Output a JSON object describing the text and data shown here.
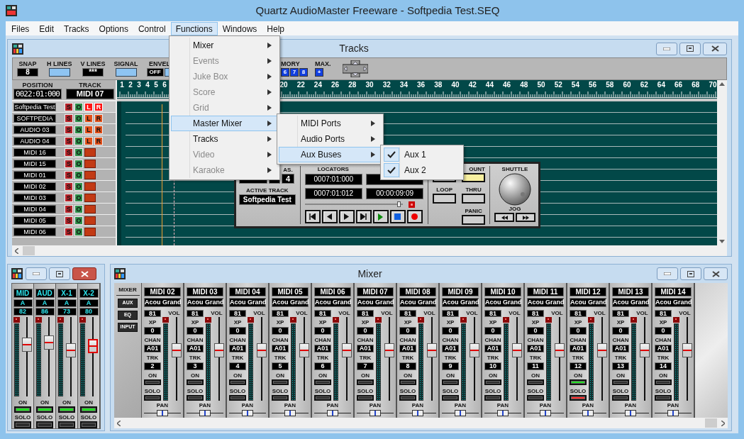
{
  "window": {
    "title": "Quartz AudioMaster Freeware - Softpedia Test.SEQ"
  },
  "menu_bar": [
    {
      "label": "Files",
      "selected": false
    },
    {
      "label": "Edit",
      "selected": false
    },
    {
      "label": "Tracks",
      "selected": false
    },
    {
      "label": "Options",
      "selected": false
    },
    {
      "label": "Control",
      "selected": false
    },
    {
      "label": "Functions",
      "selected": true
    },
    {
      "label": "Windows",
      "selected": false
    },
    {
      "label": "Help",
      "selected": false
    }
  ],
  "functions_menu": [
    {
      "label": "Mixer",
      "disabled": false,
      "selected": false
    },
    {
      "label": "Events",
      "disabled": true,
      "selected": false
    },
    {
      "label": "Juke Box",
      "disabled": true,
      "selected": false
    },
    {
      "label": "Score",
      "disabled": true,
      "selected": false
    },
    {
      "label": "Grid",
      "disabled": true,
      "selected": false
    },
    {
      "label": "Master Mixer",
      "disabled": false,
      "selected": true
    },
    {
      "label": "Tracks",
      "disabled": false,
      "selected": false
    },
    {
      "label": "Video",
      "disabled": true,
      "selected": false
    },
    {
      "label": "Karaoke",
      "disabled": true,
      "selected": false
    }
  ],
  "master_mixer_menu": [
    {
      "label": "MIDI Ports",
      "selected": false
    },
    {
      "label": "Audio Ports",
      "selected": false
    },
    {
      "label": "Aux Buses",
      "selected": true
    }
  ],
  "aux_buses_menu": [
    {
      "label": "Aux 1",
      "checked": true
    },
    {
      "label": "Aux 2",
      "checked": true
    }
  ],
  "tracks_window": {
    "title": "Tracks",
    "toolbar": [
      {
        "kind": "display",
        "label": "SNAP",
        "value": "8"
      },
      {
        "kind": "toggle",
        "label": "H LINES"
      },
      {
        "kind": "display",
        "label": "V LINES",
        "value": "***"
      },
      {
        "kind": "toggle",
        "label": "SIGNAL"
      },
      {
        "kind": "switch",
        "label": "ENVEL",
        "value": "OFF"
      }
    ],
    "toolbar_right": [
      {
        "label": "MORY",
        "buttons": [
          "6",
          "7",
          "8"
        ]
      },
      {
        "label": "MAX.",
        "buttons": [
          "+"
        ]
      }
    ],
    "position_label": "POSITION",
    "position": "0022:01:000",
    "track_label": "TRACK",
    "track": "MIDI 07",
    "ruler_start": [
      "1",
      "2",
      "3",
      "4",
      "5",
      "6"
    ],
    "ruler_end": [
      "20",
      "22",
      "24",
      "26",
      "28",
      "30",
      "32",
      "34",
      "36",
      "38",
      "40",
      "42",
      "44",
      "46",
      "48",
      "50",
      "52",
      "54",
      "56",
      "58",
      "60",
      "62",
      "64",
      "66",
      "68",
      "70"
    ],
    "tracks": [
      {
        "name": "Softpedia Test",
        "kind": "audio",
        "selected": true,
        "buttons": [
          "S",
          "O",
          "L",
          "R"
        ]
      },
      {
        "name": "SOFTPEDIA",
        "kind": "audio",
        "selected": false,
        "buttons": [
          "S",
          "O",
          "L",
          "R"
        ]
      },
      {
        "name": "AUDIO 03",
        "kind": "audio",
        "selected": false,
        "buttons": [
          "S",
          "O",
          "L",
          "R"
        ]
      },
      {
        "name": "AUDIO 04",
        "kind": "audio",
        "selected": false,
        "buttons": [
          "S",
          "O",
          "L",
          "R"
        ]
      },
      {
        "name": "MIDI 16",
        "kind": "midi",
        "selected": false,
        "buttons": [
          "S",
          "O"
        ]
      },
      {
        "name": "MIDI 15",
        "kind": "midi",
        "selected": false,
        "buttons": [
          "S",
          "O"
        ]
      },
      {
        "name": "MIDI 01",
        "kind": "midi",
        "selected": false,
        "buttons": [
          "S",
          "O"
        ]
      },
      {
        "name": "MIDI 02",
        "kind": "midi",
        "selected": false,
        "buttons": [
          "S",
          "O"
        ]
      },
      {
        "name": "MIDI 03",
        "kind": "midi",
        "selected": false,
        "buttons": [
          "S",
          "O"
        ]
      },
      {
        "name": "MIDI 04",
        "kind": "midi",
        "selected": false,
        "buttons": [
          "S",
          "O"
        ]
      },
      {
        "name": "MIDI 05",
        "kind": "midi",
        "selected": false,
        "buttons": [
          "S",
          "O"
        ]
      },
      {
        "name": "MIDI 06",
        "kind": "midi",
        "selected": false,
        "buttons": [
          "S",
          "O"
        ]
      }
    ]
  },
  "transport": {
    "meas_label": "AS.",
    "meas": "4",
    "active_track_label": "ACTIVE TRACK",
    "active_track": "Softpedia Test",
    "locators_label": "LOCATORS",
    "locators": [
      "0007:01:000",
      "0007:01:012"
    ],
    "time": "00:00:09:09",
    "position": {
      "level": 0.98
    },
    "count": {
      "label": "OUNT",
      "on": true
    },
    "loop": {
      "label": "LOOP",
      "on": false
    },
    "thru": {
      "label": "THRU",
      "on": false
    },
    "panic": {
      "label": "PANIC",
      "on": false
    },
    "shuttle_label": "SHUTTLE",
    "jog_label": "JOG"
  },
  "aux_window": {
    "channels": [
      {
        "name": "MID",
        "bank": "A",
        "value": "82",
        "on_label": "ON",
        "on": true,
        "solo_label": "SOLO",
        "solo": false,
        "level": 0.68,
        "selected": false
      },
      {
        "name": "AUD",
        "bank": "A",
        "value": "86",
        "on_label": "ON",
        "on": true,
        "solo_label": "SOLO",
        "solo": false,
        "level": 0.72,
        "selected": false
      },
      {
        "name": "X-1",
        "bank": "A",
        "value": "73",
        "on_label": "ON",
        "on": true,
        "solo_label": "SOLO",
        "solo": false,
        "level": 0.6,
        "selected": false
      },
      {
        "name": "X-2",
        "bank": "A",
        "value": "80",
        "on_label": "ON",
        "on": true,
        "solo_label": "SOLO",
        "solo": false,
        "level": 0.66,
        "selected": true
      }
    ]
  },
  "mixer_window": {
    "title": "Mixer",
    "section_label": "MIXER",
    "buttons": [
      "AUX",
      "EQ",
      "INPUT"
    ],
    "channels": [
      {
        "name": "MIDI 02",
        "instrument": "Acou Grand",
        "vol": "81",
        "vol_label": "VOL",
        "xp_label": "XP",
        "xp": "0",
        "chan_label": "CHAN",
        "chan": "A01",
        "trk_label": "TRK",
        "trk": "2",
        "on_label": "ON",
        "on": false,
        "solo_label": "SOLO",
        "solo": false,
        "level": 0.62,
        "pan": {
          "label": "PAN",
          "level": 0.5
        }
      },
      {
        "name": "MIDI 03",
        "instrument": "Acou Grand",
        "vol": "81",
        "vol_label": "VOL",
        "xp_label": "XP",
        "xp": "0",
        "chan_label": "CHAN",
        "chan": "A01",
        "trk_label": "TRK",
        "trk": "3",
        "on_label": "ON",
        "on": false,
        "solo_label": "SOLO",
        "solo": false,
        "level": 0.62,
        "pan": {
          "label": "PAN",
          "level": 0.5
        }
      },
      {
        "name": "MIDI 04",
        "instrument": "Acou Grand",
        "vol": "81",
        "vol_label": "VOL",
        "xp_label": "XP",
        "xp": "0",
        "chan_label": "CHAN",
        "chan": "A01",
        "trk_label": "TRK",
        "trk": "4",
        "on_label": "ON",
        "on": false,
        "solo_label": "SOLO",
        "solo": false,
        "level": 0.62,
        "pan": {
          "label": "PAN",
          "level": 0.5
        }
      },
      {
        "name": "MIDI 05",
        "instrument": "Acou Grand",
        "vol": "81",
        "vol_label": "VOL",
        "xp_label": "XP",
        "xp": "0",
        "chan_label": "CHAN",
        "chan": "A01",
        "trk_label": "TRK",
        "trk": "5",
        "on_label": "ON",
        "on": false,
        "solo_label": "SOLO",
        "solo": false,
        "level": 0.62,
        "pan": {
          "label": "PAN",
          "level": 0.5
        }
      },
      {
        "name": "MIDI 06",
        "instrument": "Acou Grand",
        "vol": "81",
        "vol_label": "VOL",
        "xp_label": "XP",
        "xp": "0",
        "chan_label": "CHAN",
        "chan": "A01",
        "trk_label": "TRK",
        "trk": "6",
        "on_label": "ON",
        "on": false,
        "solo_label": "SOLO",
        "solo": false,
        "level": 0.62,
        "pan": {
          "label": "PAN",
          "level": 0.5
        }
      },
      {
        "name": "MIDI 07",
        "instrument": "Acou Grand",
        "vol": "81",
        "vol_label": "VOL",
        "xp_label": "XP",
        "xp": "0",
        "chan_label": "CHAN",
        "chan": "A01",
        "trk_label": "TRK",
        "trk": "7",
        "on_label": "ON",
        "on": false,
        "solo_label": "SOLO",
        "solo": false,
        "level": 0.62,
        "pan": {
          "label": "PAN",
          "level": 0.5
        }
      },
      {
        "name": "MIDI 08",
        "instrument": "Acou Grand",
        "vol": "81",
        "vol_label": "VOL",
        "xp_label": "XP",
        "xp": "0",
        "chan_label": "CHAN",
        "chan": "A01",
        "trk_label": "TRK",
        "trk": "8",
        "on_label": "ON",
        "on": false,
        "solo_label": "SOLO",
        "solo": false,
        "level": 0.62,
        "pan": {
          "label": "PAN",
          "level": 0.5
        }
      },
      {
        "name": "MIDI 09",
        "instrument": "Acou Grand",
        "vol": "81",
        "vol_label": "VOL",
        "xp_label": "XP",
        "xp": "0",
        "chan_label": "CHAN",
        "chan": "A01",
        "trk_label": "TRK",
        "trk": "9",
        "on_label": "ON",
        "on": false,
        "solo_label": "SOLO",
        "solo": false,
        "level": 0.62,
        "pan": {
          "label": "PAN",
          "level": 0.5
        }
      },
      {
        "name": "MIDI 10",
        "instrument": "Acou Grand",
        "vol": "81",
        "vol_label": "VOL",
        "xp_label": "XP",
        "xp": "0",
        "chan_label": "CHAN",
        "chan": "A01",
        "trk_label": "TRK",
        "trk": "10",
        "on_label": "ON",
        "on": false,
        "solo_label": "SOLO",
        "solo": false,
        "level": 0.62,
        "pan": {
          "label": "PAN",
          "level": 0.5
        }
      },
      {
        "name": "MIDI 11",
        "instrument": "Acou Grand",
        "vol": "81",
        "vol_label": "VOL",
        "xp_label": "XP",
        "xp": "0",
        "chan_label": "CHAN",
        "chan": "A01",
        "trk_label": "TRK",
        "trk": "11",
        "on_label": "ON",
        "on": false,
        "solo_label": "SOLO",
        "solo": false,
        "level": 0.62,
        "pan": {
          "label": "PAN",
          "level": 0.5
        }
      },
      {
        "name": "MIDI 12",
        "instrument": "Acou Grand",
        "vol": "81",
        "vol_label": "VOL",
        "xp_label": "XP",
        "xp": "0",
        "chan_label": "CHAN",
        "chan": "A01",
        "trk_label": "TRK",
        "trk": "12",
        "on_label": "ON",
        "on": true,
        "solo_label": "SOLO",
        "solo": true,
        "level": 0.62,
        "pan": {
          "label": "PAN",
          "level": 0.5
        }
      },
      {
        "name": "MIDI 13",
        "instrument": "Acou Grand",
        "vol": "81",
        "vol_label": "VOL",
        "xp_label": "XP",
        "xp": "0",
        "chan_label": "CHAN",
        "chan": "A01",
        "trk_label": "TRK",
        "trk": "13",
        "on_label": "ON",
        "on": false,
        "solo_label": "SOLO",
        "solo": false,
        "level": 0.62,
        "pan": {
          "label": "PAN",
          "level": 0.5
        }
      },
      {
        "name": "MIDI 14",
        "instrument": "Acou Grand",
        "vol": "81",
        "vol_label": "VOL",
        "xp_label": "XP",
        "xp": "0",
        "chan_label": "CHAN",
        "chan": "A01",
        "trk_label": "TRK",
        "trk": "14",
        "on_label": "ON",
        "on": false,
        "solo_label": "SOLO",
        "solo": false,
        "level": 0.62,
        "pan": {
          "label": "PAN",
          "level": 0.5
        }
      }
    ]
  }
}
